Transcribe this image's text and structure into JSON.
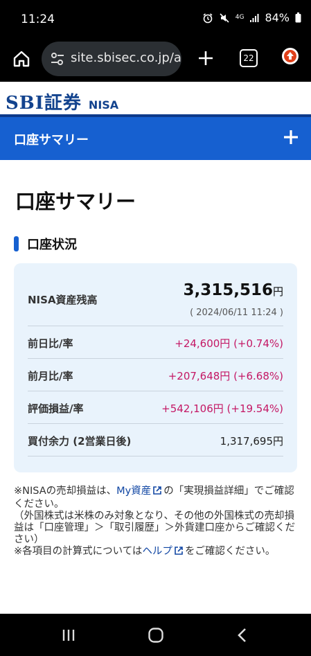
{
  "status_bar": {
    "time": "11:24",
    "network": "4G",
    "battery": "84%"
  },
  "browser": {
    "url": "site.sbisec.co.jp/a",
    "tab_count": "22"
  },
  "header": {
    "brand": "SBI証券",
    "product": "NISA"
  },
  "nav": {
    "title": "口座サマリー"
  },
  "page": {
    "title": "口座サマリー",
    "section": "口座状況"
  },
  "summary": {
    "total_label": "NISA資産残高",
    "total_value": "3,315,516",
    "total_unit": "円",
    "as_of": "( 2024/06/11 11:24 )",
    "rows": [
      {
        "label": "前日比/率",
        "value": "+24,600円 (+0.74%)"
      },
      {
        "label": "前月比/率",
        "value": "+207,648円 (+6.68%)"
      },
      {
        "label": "評価損益/率",
        "value": "+542,106円 (+19.54%)"
      },
      {
        "label": "買付余力 (2営業日後)",
        "value": "1,317,695円"
      }
    ]
  },
  "notes": {
    "n1_a": "※NISAの売却損益は、",
    "n1_link": "My資産",
    "n1_b": "の「実現損益詳細」でご確認ください。",
    "n2": "（外国株式は米株のみ対象となり、その他の外国株式の売却損益は「口座管理」＞「取引履歴」＞外貨建口座からご確認ください）",
    "n3_a": "※各項目の計算式については",
    "n3_link": "ヘルプ",
    "n3_b": "をご確認ください。"
  },
  "colors": {
    "brand": "#13438e",
    "nav_blue": "#1660d0",
    "card_bg": "#e9f3fc",
    "positive": "#c41764",
    "link": "#1046a3"
  }
}
